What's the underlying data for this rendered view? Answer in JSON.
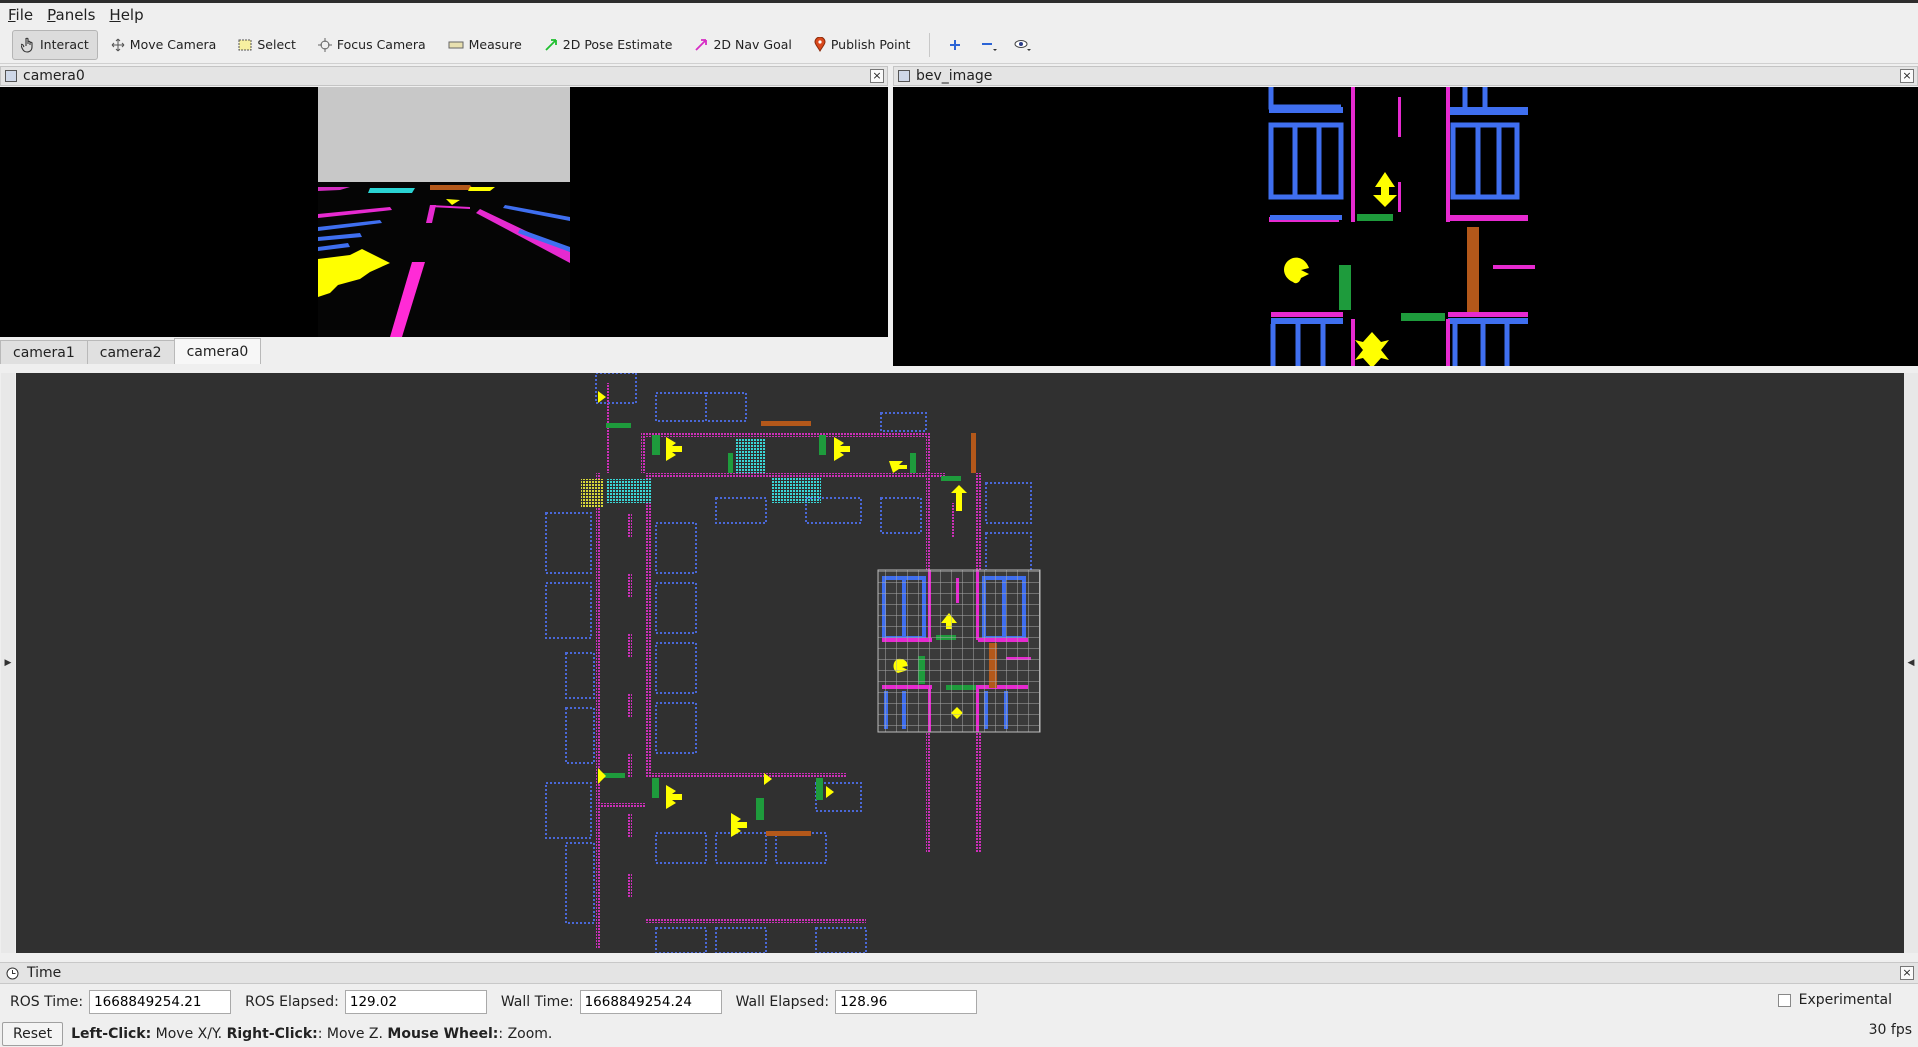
{
  "menu": {
    "file": "File",
    "panels": "Panels",
    "help": "Help"
  },
  "toolbar": {
    "interact": "Interact",
    "move_camera": "Move Camera",
    "select": "Select",
    "focus_camera": "Focus Camera",
    "measure": "Measure",
    "pose_estimate": "2D Pose Estimate",
    "nav_goal": "2D Nav Goal",
    "publish_point": "Publish Point"
  },
  "panels": {
    "camera_title": "camera0",
    "bev_title": "bev_image"
  },
  "tabs": [
    "camera1",
    "camera2",
    "camera0"
  ],
  "time": {
    "title": "Time",
    "ros_time_label": "ROS Time:",
    "ros_time": "1668849254.21",
    "ros_elapsed_label": "ROS Elapsed:",
    "ros_elapsed": "129.02",
    "wall_time_label": "Wall Time:",
    "wall_time": "1668849254.24",
    "wall_elapsed_label": "Wall Elapsed:",
    "wall_elapsed": "128.96",
    "experimental": "Experimental"
  },
  "status": {
    "reset": "Reset",
    "left_click": "Left-Click:",
    "left_click_desc": " Move X/Y.",
    "right_click": "Right-Click:",
    "right_click_desc": ": Move Z.",
    "wheel": "Mouse Wheel:",
    "wheel_desc": ": Zoom.",
    "fps": "30 fps"
  },
  "colors": {
    "lane": "#ff2bd6",
    "building": "#3f6ff0",
    "arrow": "#ffff00",
    "grass": "#1e9b3c",
    "crosswalk": "#33e0e0",
    "brown": "#b3581a"
  }
}
